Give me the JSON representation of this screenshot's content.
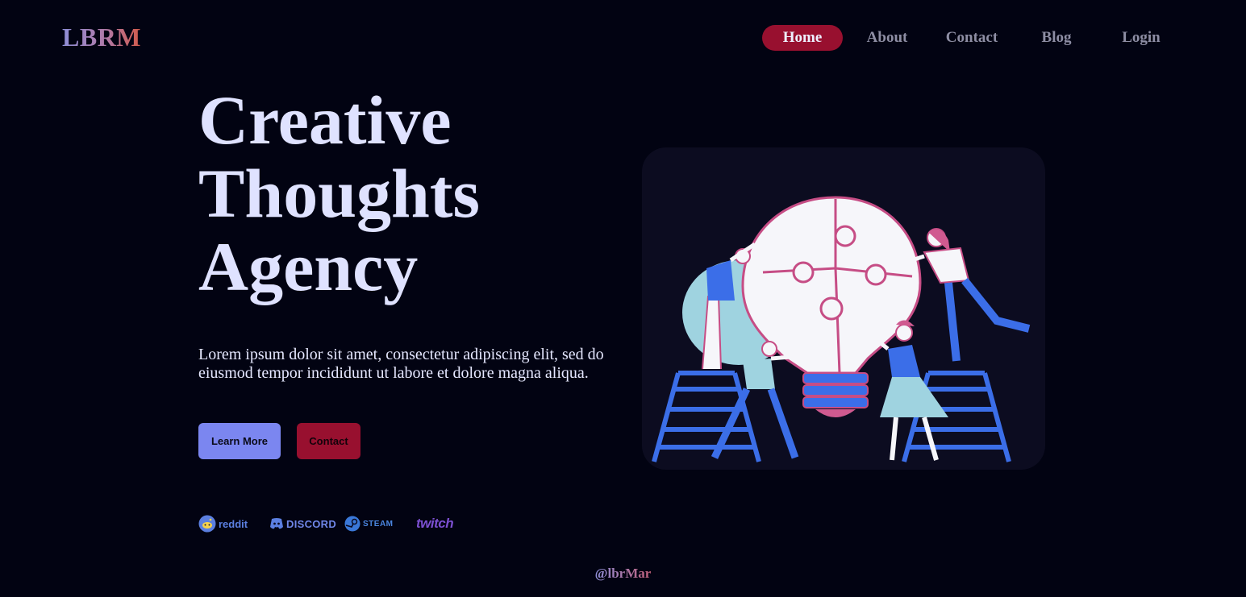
{
  "brand": {
    "logo_text": "LBRM"
  },
  "nav": {
    "items": [
      {
        "label": "Home",
        "active": true
      },
      {
        "label": "About",
        "active": false
      },
      {
        "label": "Contact",
        "active": false
      },
      {
        "label": "Blog",
        "active": false
      },
      {
        "label": "Login",
        "active": false
      }
    ]
  },
  "hero": {
    "title_lines": [
      "Creative",
      "Thoughts",
      "Agency"
    ],
    "description": "Lorem ipsum dolor sit amet, consectetur adipiscing elit, sed do eiusmod tempor incididunt ut labore et dolore magna aliqua.",
    "primary_button": "Learn More",
    "secondary_button": "Contact"
  },
  "partners": [
    {
      "name": "reddit",
      "icon": "reddit-icon",
      "color": "#5b7fe0"
    },
    {
      "name": "DISCORD",
      "icon": "discord-icon",
      "color": "#5b7fe0"
    },
    {
      "name": "STEAM",
      "icon": "steam-icon",
      "color": "#3a78d8"
    },
    {
      "name": "twitch",
      "icon": "twitch-icon",
      "color": "#7b4fd0"
    }
  ],
  "illustration": {
    "icon": "puzzle-lightbulb-teamwork-illustration"
  },
  "footer": {
    "handle": "@lbrMar"
  },
  "colors": {
    "background": "#020312",
    "accent_primary": "#7b86f0",
    "accent_secondary": "#98102f",
    "nav_inactive": "#8e8ea4",
    "title": "#dfe2ff"
  }
}
